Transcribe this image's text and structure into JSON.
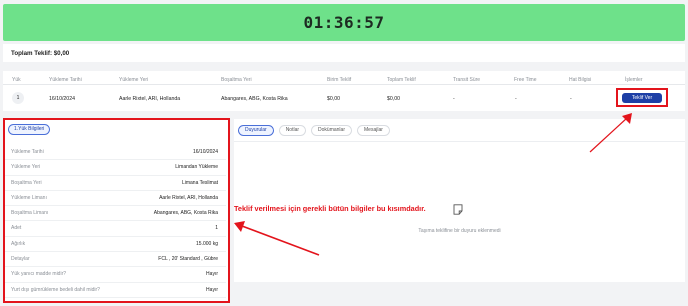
{
  "timer": {
    "value": "01:36:57"
  },
  "summary": {
    "total_offer": "Toplam Teklif: $0,00"
  },
  "table": {
    "headers": [
      "Yük",
      "Yükleme Tarihi",
      "Yükleme Yeri",
      "Boşaltma Yeri",
      "Birim Teklif",
      "Toplam Teklif",
      "Transit Süre",
      "Free Time",
      "Hat Bilgisi",
      "İşlemler"
    ],
    "row": {
      "yuk": "1",
      "loading_date": "16/10/2024",
      "loading_place": "Aarle Rixtel, ARI, Hollanda",
      "unloading_place": "Abangares, ABG, Kosta Rika",
      "unit_offer": "$0,00",
      "total_offer": "$0,00",
      "transit_time": "-",
      "free_time": "-",
      "line_info": "-",
      "action_label": "Teklif Ver"
    }
  },
  "load_info": {
    "tab_label": "1.Yük Bilgileri",
    "rows": [
      {
        "label": "Yükleme Tarihi",
        "value": "16/10/2024"
      },
      {
        "label": "Yükleme Yeri",
        "value": "Limandan Yükleme"
      },
      {
        "label": "Boşaltma Yeri",
        "value": "Limana Teslimat"
      },
      {
        "label": "Yükleme Limanı",
        "value": "Aarle Rixtel, ARI, Hollanda"
      },
      {
        "label": "Boşaltma Limanı",
        "value": "Abangares, ABG, Kosta Rika"
      },
      {
        "label": "Adet",
        "value": "1"
      },
      {
        "label": "Ağırlık",
        "value": "15.000 kg"
      },
      {
        "label": "Detaylar",
        "value": "FCL , 20' Standard , Gübre"
      },
      {
        "label": "Yük yanıcı madde midir?",
        "value": "Hayır"
      },
      {
        "label": "Yurt dışı gümrükleme bedeli dahil midir?",
        "value": "Hayır"
      }
    ]
  },
  "right_panel": {
    "tabs": [
      "Duyurular",
      "Notlar",
      "Dokümanlar",
      "Mesajlar"
    ],
    "empty_text": "Taşıma teklifine bir duyuru eklenmedi"
  },
  "annotation": {
    "text": "Teklif verilmesi için gerekli bütün bilgiler bu kısımdadır."
  },
  "colors": {
    "timer_bg": "#6ee18a",
    "primary": "#1d3fa6",
    "highlight": "#e3141c"
  },
  "icons": [
    "document-icon",
    "arrow-annotation"
  ]
}
